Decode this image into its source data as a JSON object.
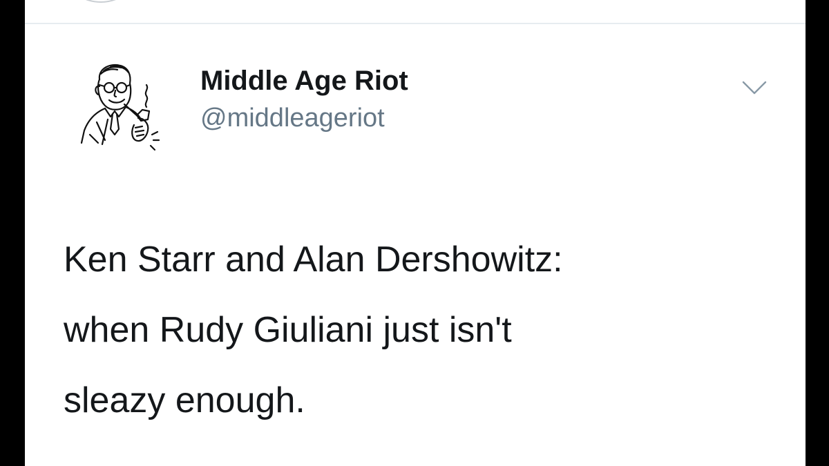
{
  "tweet": {
    "author": {
      "display_name": "Middle Age Riot",
      "handle": "@middleageriot",
      "avatar_icon": "pipe-smoking-man-avatar-icon"
    },
    "menu_icon": "chevron-down-icon",
    "text": "Ken Starr and Alan Dershowitz:\nwhen Rudy Giuliani just isn't\nsleazy enough."
  },
  "colors": {
    "background_bar": "#000000",
    "panel": "#ffffff",
    "name": "#14171a",
    "handle": "#657786",
    "divider": "#e6ecf0",
    "caret": "#8899a6"
  }
}
